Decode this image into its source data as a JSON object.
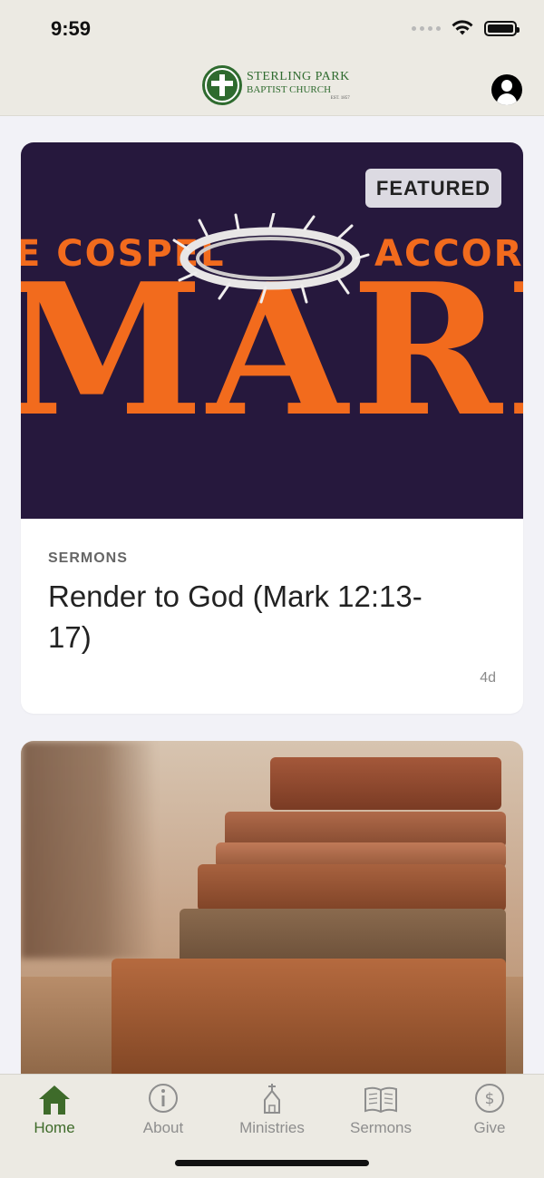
{
  "status_bar": {
    "time": "9:59"
  },
  "header": {
    "logo_line1": "STERLING PARK",
    "logo_line2": "BAPTIST CHURCH",
    "logo_line3": "EST. 1857"
  },
  "feed": {
    "featured_card": {
      "badge": "FEATURED",
      "image_text_left": "E COSPEL",
      "image_text_right": "ACCORDIN",
      "image_title": "MARK",
      "category": "SERMONS",
      "title": "Render to God (Mark 12:13-17)",
      "age": "4d"
    }
  },
  "tabbar": {
    "items": [
      {
        "label": "Home",
        "icon": "home-icon",
        "active": true
      },
      {
        "label": "About",
        "icon": "info-icon",
        "active": false
      },
      {
        "label": "Ministries",
        "icon": "church-icon",
        "active": false
      },
      {
        "label": "Sermons",
        "icon": "bible-icon",
        "active": false
      },
      {
        "label": "Give",
        "icon": "dollar-icon",
        "active": false
      }
    ]
  },
  "colors": {
    "accent": "#3e6b2a",
    "header_bg": "#eceae3",
    "mark_orange": "#f26b1d",
    "mark_bg": "#26183d"
  }
}
